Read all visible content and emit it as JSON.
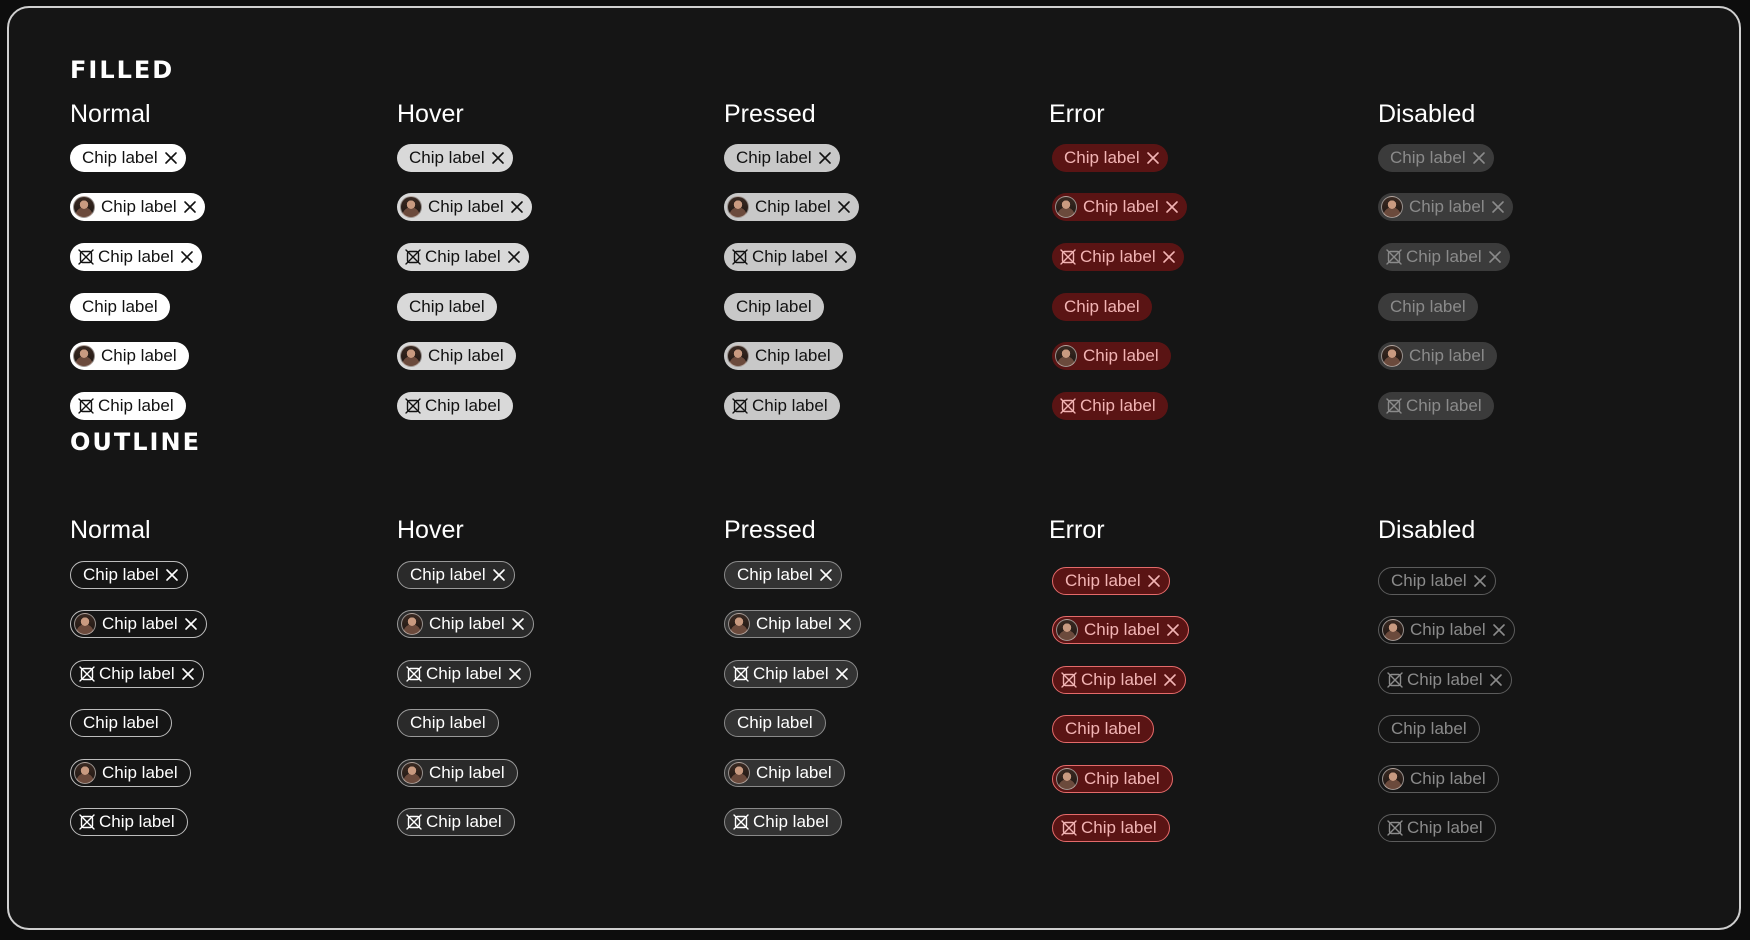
{
  "sections": {
    "filled": {
      "title": "FILLED"
    },
    "outline": {
      "title": "OUTLINE"
    }
  },
  "columns": [
    "Normal",
    "Hover",
    "Pressed",
    "Error",
    "Disabled"
  ],
  "chip": {
    "label": "Chip label"
  },
  "rows": [
    {
      "lead": "none",
      "close": true
    },
    {
      "lead": "avatar",
      "close": true
    },
    {
      "lead": "icon",
      "close": true
    },
    {
      "lead": "none",
      "close": false
    },
    {
      "lead": "avatar",
      "close": false
    },
    {
      "lead": "icon",
      "close": false
    }
  ],
  "icons": {
    "lead_icon": "crossed-square-icon",
    "close_icon": "close-icon",
    "avatar": "avatar"
  },
  "colors": {
    "background": "#151515",
    "filled_normal": "#ffffff",
    "filled_hover": "#d9d9d9",
    "filled_pressed": "#c8c8c8",
    "filled_error": "#5a1414",
    "filled_disabled": "#3b3b3b",
    "outline_error_border": "#e46a6a"
  }
}
